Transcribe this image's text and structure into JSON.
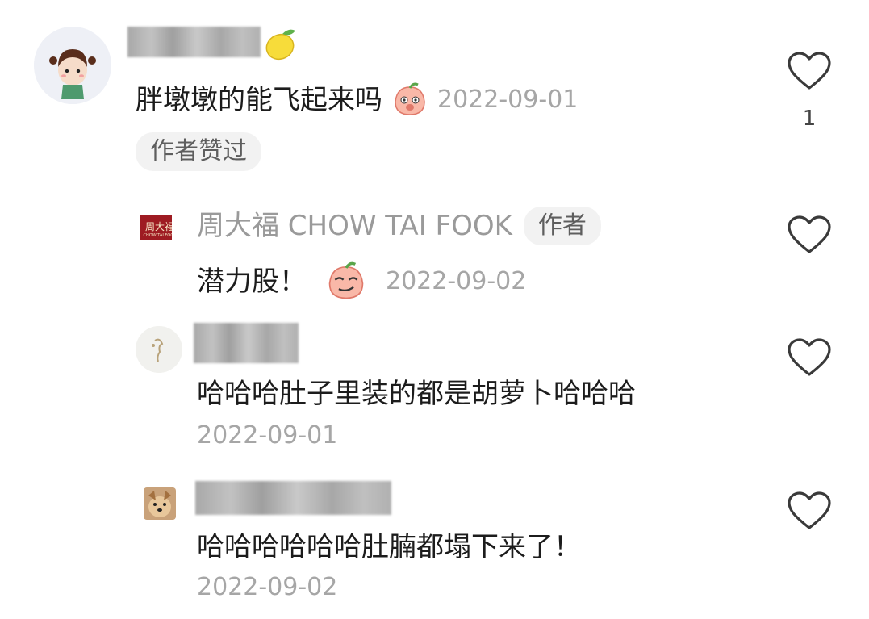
{
  "comments": [
    {
      "text": "胖墩墩的能飞起来吗",
      "date": "2022-09-01",
      "badge": "作者赞过",
      "likes": "1",
      "username_emoji": "lemon-icon",
      "text_emoji": "peach-face-icon"
    },
    {
      "author_name": "周大福 CHOW TAI FOOK",
      "author_tag": "作者",
      "text": "潜力股！",
      "date": "2022-09-02",
      "text_emoji": "peach-smirk-icon"
    },
    {
      "text": "哈哈哈肚子里装的都是胡萝卜哈哈哈",
      "date": "2022-09-01"
    },
    {
      "text": "哈哈哈哈哈哈肚腩都塌下来了！",
      "date": "2022-09-02"
    }
  ],
  "colors": {
    "text": "#1c1c1c",
    "muted": "#a6a6a6",
    "author_name": "#9a9a9a",
    "pill_bg": "#f2f2f2",
    "brand_red": "#9e1b22"
  }
}
